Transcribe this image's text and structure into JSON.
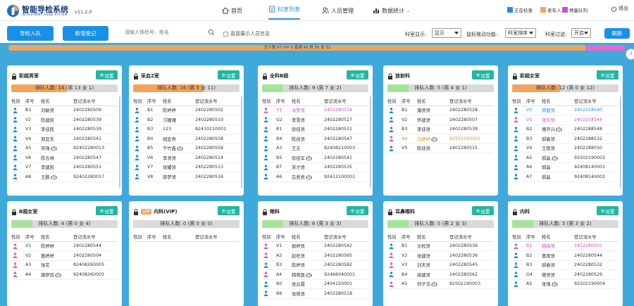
{
  "app": {
    "title": "智能导检系统",
    "subtitle": "INTELLIGENT GUIDE SYSTEM",
    "version": "v11.2.0"
  },
  "nav": [
    {
      "label": "首页",
      "icon": "home-icon"
    },
    {
      "label": "科室列表",
      "icon": "list-icon"
    },
    {
      "label": "人员管理",
      "icon": "users-icon"
    },
    {
      "label": "数据统计",
      "icon": "chart-icon"
    }
  ],
  "legend": [
    {
      "label": "正在检查",
      "color": "#1890e8"
    },
    {
      "label": "老年人",
      "color": "#f2a35e"
    },
    {
      "label": "预备队列",
      "color": "#c94fd0"
    }
  ],
  "logout_label": "退出",
  "toolbar": {
    "import_label": "导检入队",
    "register_label": "新增登记",
    "search_placeholder": "请输入体检号、姓名",
    "show_all_label": "直接展示人员信息",
    "display_label": "科室显示:",
    "display_value": "显示",
    "drag_label": "鼠标拖动功能:",
    "drag_value": "科室排序",
    "filter_label": "科室过滤:",
    "filter_value": "开启",
    "refresh_label": "刷新"
  },
  "progress": {
    "text": "总人数 67  VIP 0  普通 46  男 35  女 32",
    "pink_fraction": 0.065
  },
  "columns": [
    "性别",
    "序号",
    "姓名",
    "登记流水号"
  ],
  "panels": [
    {
      "name": "彩超男室",
      "vip": "",
      "settings": "设置",
      "queue": "排队人数: 14 (男 13 女 1)",
      "queue_fill": "#f2a35e",
      "queue_frac": 0.52,
      "rows": [
        {
          "g": "m",
          "no": "B1",
          "name": "刘敏贤",
          "id": "2402280509",
          "c": ""
        },
        {
          "g": "m",
          "no": "V2",
          "name": "陈建民",
          "id": "2402280539",
          "c": ""
        },
        {
          "g": "m",
          "no": "V3",
          "name": "李佳民",
          "id": "2402280539",
          "c": ""
        },
        {
          "g": "m",
          "no": "V4",
          "name": "郑亚东",
          "id": "2402280541",
          "c": ""
        },
        {
          "g": "m",
          "no": "A5",
          "name": "宋强",
          "id": "92402280013",
          "c": "",
          "r": true
        },
        {
          "g": "m",
          "no": "V6",
          "name": "陈吉林",
          "id": "2402280547",
          "c": ""
        },
        {
          "g": "m",
          "no": "V7",
          "name": "李建民",
          "id": "2402280551",
          "c": ""
        },
        {
          "g": "m",
          "no": "A8",
          "name": "王鹏",
          "id": "92402280017",
          "c": "",
          "r": true
        }
      ]
    },
    {
      "name": "采血2室",
      "vip": "",
      "settings": "设置",
      "queue": "排队人数: 16 (男 5 女 11)",
      "queue_fill": "#f2a35e",
      "queue_frac": 0.66,
      "rows": [
        {
          "g": "m",
          "no": "B1",
          "name": "陈婷婷",
          "id": "2402280502",
          "c": ""
        },
        {
          "g": "m",
          "no": "B2",
          "name": "习珊珊",
          "id": "2402280510",
          "c": ""
        },
        {
          "g": "m",
          "no": "B3",
          "name": "123",
          "id": "82410210001",
          "c": ""
        },
        {
          "g": "m",
          "no": "B4",
          "name": "胡宏亮",
          "id": "2402280508",
          "c": ""
        },
        {
          "g": "m",
          "no": "B5",
          "name": "千竹鑫",
          "id": "2402280558",
          "c": "",
          "r": true
        },
        {
          "g": "m",
          "no": "V6",
          "name": "李贤贤",
          "id": "2402280514",
          "c": ""
        },
        {
          "g": "m",
          "no": "V7",
          "name": "张耀贤",
          "id": "2402280513",
          "c": ""
        },
        {
          "g": "m",
          "no": "V8",
          "name": "薛梦贤",
          "id": "2402280516",
          "c": ""
        }
      ]
    },
    {
      "name": "全科B超",
      "vip": "",
      "settings": "设置",
      "queue": "排队人数: 9 (男 7 女 2)",
      "queue_fill": "#a6e39a",
      "queue_frac": 0.2,
      "rows": [
        {
          "g": "f",
          "no": "V1",
          "name": "冰梦贤",
          "id": "2402280534",
          "c": "pink"
        },
        {
          "g": "m",
          "no": "G2",
          "name": "李雪贤",
          "id": "2402280527",
          "c": ""
        },
        {
          "g": "m",
          "no": "B1",
          "name": "徐佳贤",
          "id": "2402280531",
          "c": ""
        },
        {
          "g": "m",
          "no": "B4",
          "name": "陈佳贤",
          "id": "2402280547",
          "c": ""
        },
        {
          "g": "m",
          "no": "A3",
          "name": "王吉",
          "id": "82408210003",
          "c": ""
        },
        {
          "g": "m",
          "no": "B5",
          "name": "徐佳军",
          "id": "2402280541",
          "c": "",
          "r": true
        },
        {
          "g": "m",
          "no": "B7",
          "name": "宋才贤",
          "id": "2402280535",
          "c": ""
        },
        {
          "g": "m",
          "no": "A6",
          "name": "吕君君",
          "id": "92412100001",
          "c": "",
          "r": true
        }
      ]
    },
    {
      "name": "放射科",
      "vip": "",
      "settings": "设置",
      "queue": "排队人数: 5 (男 4 女 1)",
      "queue_fill": "#a6e39a",
      "queue_frac": 0.2,
      "rows": [
        {
          "g": "m",
          "no": "B1",
          "name": "蒲贤贤",
          "id": "2402280528",
          "c": ""
        },
        {
          "g": "m",
          "no": "V2",
          "name": "怀建贤",
          "id": "2402280507",
          "c": ""
        },
        {
          "g": "m",
          "no": "B3",
          "name": "李佳贤",
          "id": "2402280539",
          "c": ""
        },
        {
          "g": "f",
          "no": "A4",
          "name": "汪婷婷",
          "id": "92502190001",
          "c": "orange",
          "r": true
        },
        {
          "g": "m",
          "no": "V5",
          "name": "陈佳贤",
          "id": "2402280515",
          "c": ""
        }
      ]
    },
    {
      "name": "彩超女室",
      "vip": "",
      "settings": "设置",
      "queue": "排队人数: 12 (男 0 女 12)",
      "queue_fill": "#f2a35e",
      "queue_frac": 0.45,
      "rows": [
        {
          "g": "m",
          "no": "V0",
          "name": "周丽贤",
          "id": "2402258540",
          "c": "blue"
        },
        {
          "g": "f",
          "no": "V1",
          "name": "张玲贤",
          "id": "2402258544",
          "c": "pink"
        },
        {
          "g": "m",
          "no": "B2",
          "name": "傅开兴",
          "id": "2402288548",
          "c": "",
          "r": true
        },
        {
          "g": "m",
          "no": "B3",
          "name": "郝春贤",
          "id": "2402288532",
          "c": ""
        },
        {
          "g": "m",
          "no": "V4",
          "name": "王雨贤",
          "id": "2402288550",
          "c": ""
        },
        {
          "g": "m",
          "no": "A5",
          "name": "郝晶",
          "id": "92502190002",
          "c": "",
          "r": true
        },
        {
          "g": "m",
          "no": "A6",
          "name": "郝晶",
          "id": "92408140001",
          "c": ""
        },
        {
          "g": "m",
          "no": "A7",
          "name": "郝晶",
          "id": "92408140002",
          "c": ""
        }
      ]
    },
    {
      "name": "B超女室",
      "vip": "",
      "settings": "设置",
      "queue": "排队人数: 4 (男 0 女 4)",
      "queue_fill": "#a6e39a",
      "queue_frac": 0.2,
      "rows": [
        {
          "g": "f",
          "no": "V1",
          "name": "陈婷婷",
          "id": "2402280544",
          "c": ""
        },
        {
          "g": "f",
          "no": "V2",
          "name": "葛婷婷",
          "id": "2402280504",
          "c": ""
        },
        {
          "g": "f",
          "no": "A3",
          "name": "张花",
          "id": "82408260005",
          "c": ""
        },
        {
          "g": "f",
          "no": "A4",
          "name": "唐伊凤",
          "id": "92408260005",
          "c": "",
          "r": true
        }
      ]
    },
    {
      "name": "内科(VIP)",
      "vip": "VIP",
      "settings": "设置",
      "queue": "排队人数: 0 (男 0 女 0)",
      "queue_fill": "#a6e39a",
      "queue_frac": 0.0,
      "rows": []
    },
    {
      "name": "眼科",
      "vip": "",
      "settings": "设置",
      "queue": "排队人数: 6 (男 3 女 3)",
      "queue_fill": "#a6e39a",
      "queue_frac": 0.2,
      "rows": [
        {
          "g": "f",
          "no": "V1",
          "name": "佩婷贤",
          "id": "2402280542",
          "c": ""
        },
        {
          "g": "f",
          "no": "A2",
          "name": "赵旺贤",
          "id": "2402280565",
          "c": ""
        },
        {
          "g": "m",
          "no": "B3",
          "name": "陈婷贤",
          "id": "2402280582",
          "c": ""
        },
        {
          "g": "f",
          "no": "A4",
          "name": "韩晓磊",
          "id": "92466040001",
          "c": "",
          "r": true
        },
        {
          "g": "m",
          "no": "B0",
          "name": "张云霞",
          "id": "2404150001",
          "c": ""
        },
        {
          "g": "m",
          "no": "B6",
          "name": "张晓贤",
          "id": "2402280518",
          "c": ""
        }
      ]
    },
    {
      "name": "耳鼻喉科",
      "vip": "",
      "settings": "设置",
      "queue": "排队人数: 5 (男 2 女 3)",
      "queue_fill": "#a6e39a",
      "queue_frac": 0.2,
      "rows": [
        {
          "g": "m",
          "no": "B1",
          "name": "文权贤",
          "id": "2402280536",
          "c": ""
        },
        {
          "g": "f",
          "no": "V2",
          "name": "张建贤",
          "id": "2402280536",
          "c": ""
        },
        {
          "g": "f",
          "no": "V3",
          "name": "刘天贤",
          "id": "2402280545",
          "c": ""
        },
        {
          "g": "m",
          "no": "B4",
          "name": "高建贤",
          "id": "2402280562",
          "c": ""
        },
        {
          "g": "f",
          "no": "A5",
          "name": "何子浩",
          "id": "92502190003",
          "c": "",
          "r": true
        }
      ]
    },
    {
      "name": "内科",
      "vip": "",
      "settings": "设置",
      "queue": "排队人数: 5 (男 3 女 2)",
      "queue_fill": "#a6e39a",
      "queue_frac": 0.2,
      "rows": [
        {
          "g": "f",
          "no": "B1",
          "name": "韩梅贤",
          "id": "2402280501",
          "c": "pink"
        },
        {
          "g": "m",
          "no": "B2",
          "name": "葛雨贤",
          "id": "2402280544",
          "c": ""
        },
        {
          "g": "m",
          "no": "B3",
          "name": "郝春贤",
          "id": "2402280532",
          "c": ""
        },
        {
          "g": "m",
          "no": "G4",
          "name": "德贤贤",
          "id": "2402280529",
          "c": ""
        },
        {
          "g": "m",
          "no": "A5",
          "name": "张强",
          "id": "92502190004",
          "c": "",
          "r": true
        }
      ]
    }
  ]
}
